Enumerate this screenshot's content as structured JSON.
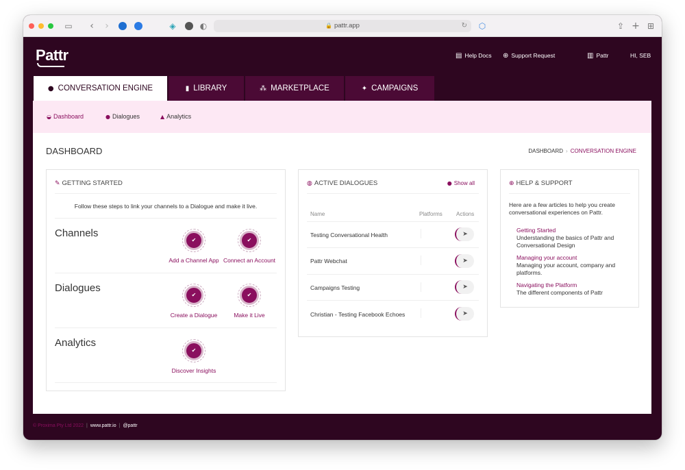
{
  "browser": {
    "url": "pattr.app"
  },
  "app": {
    "logo": "Pattr",
    "header_links": {
      "help_docs": "Help Docs",
      "support_request": "Support Request",
      "org": "Pattr",
      "user": "Hi, SEB"
    },
    "tabs": [
      {
        "label": "CONVERSATION ENGINE",
        "active": true
      },
      {
        "label": "LIBRARY"
      },
      {
        "label": "MARKETPLACE"
      },
      {
        "label": "CAMPAIGNS"
      }
    ],
    "subnav": [
      {
        "label": "Dashboard",
        "active": true
      },
      {
        "label": "Dialogues"
      },
      {
        "label": "Analytics"
      }
    ],
    "page_title": "DASHBOARD",
    "breadcrumb": {
      "root": "DASHBOARD",
      "current": "CONVERSATION ENGINE"
    }
  },
  "getting_started": {
    "title": "GETTING STARTED",
    "intro": "Follow these steps to link your channels to a Dialogue and make it live.",
    "sections": [
      {
        "heading": "Channels",
        "steps": [
          "Add a Channel App",
          "Connect an Account"
        ]
      },
      {
        "heading": "Dialogues",
        "steps": [
          "Create a Dialogue",
          "Make it Live"
        ]
      },
      {
        "heading": "Analytics",
        "steps": [
          "Discover Insights"
        ]
      }
    ]
  },
  "active_dialogues": {
    "title": "ACTIVE DIALOGUES",
    "show_all": "Show all",
    "columns": [
      "Name",
      "Platforms",
      "Actions"
    ],
    "rows": [
      {
        "name": "Testing Conversational Health"
      },
      {
        "name": "Pattr Webchat"
      },
      {
        "name": "Campaigns Testing"
      },
      {
        "name": "Christian - Testing Facebook Echoes"
      }
    ]
  },
  "help_support": {
    "title": "HELP & SUPPORT",
    "intro": "Here are a few articles to help you create conversational experiences on Pattr.",
    "articles": [
      {
        "title": "Getting Started",
        "desc": "Understanding the basics of Pattr and Conversational Design"
      },
      {
        "title": "Managing your account",
        "desc": "Managing your account, company and platforms."
      },
      {
        "title": "Navigating the Platform",
        "desc": "The different components of Pattr"
      }
    ]
  },
  "footer": {
    "copyright": "© Proxima Pty Ltd 2022",
    "site": "www.pattr.io",
    "handle": "@pattr"
  },
  "colors": {
    "brand_dark": "#2e0620",
    "tab_bg": "#4b0a35",
    "accent": "#8a0f5e",
    "subnav_bg": "#fde8f4"
  }
}
